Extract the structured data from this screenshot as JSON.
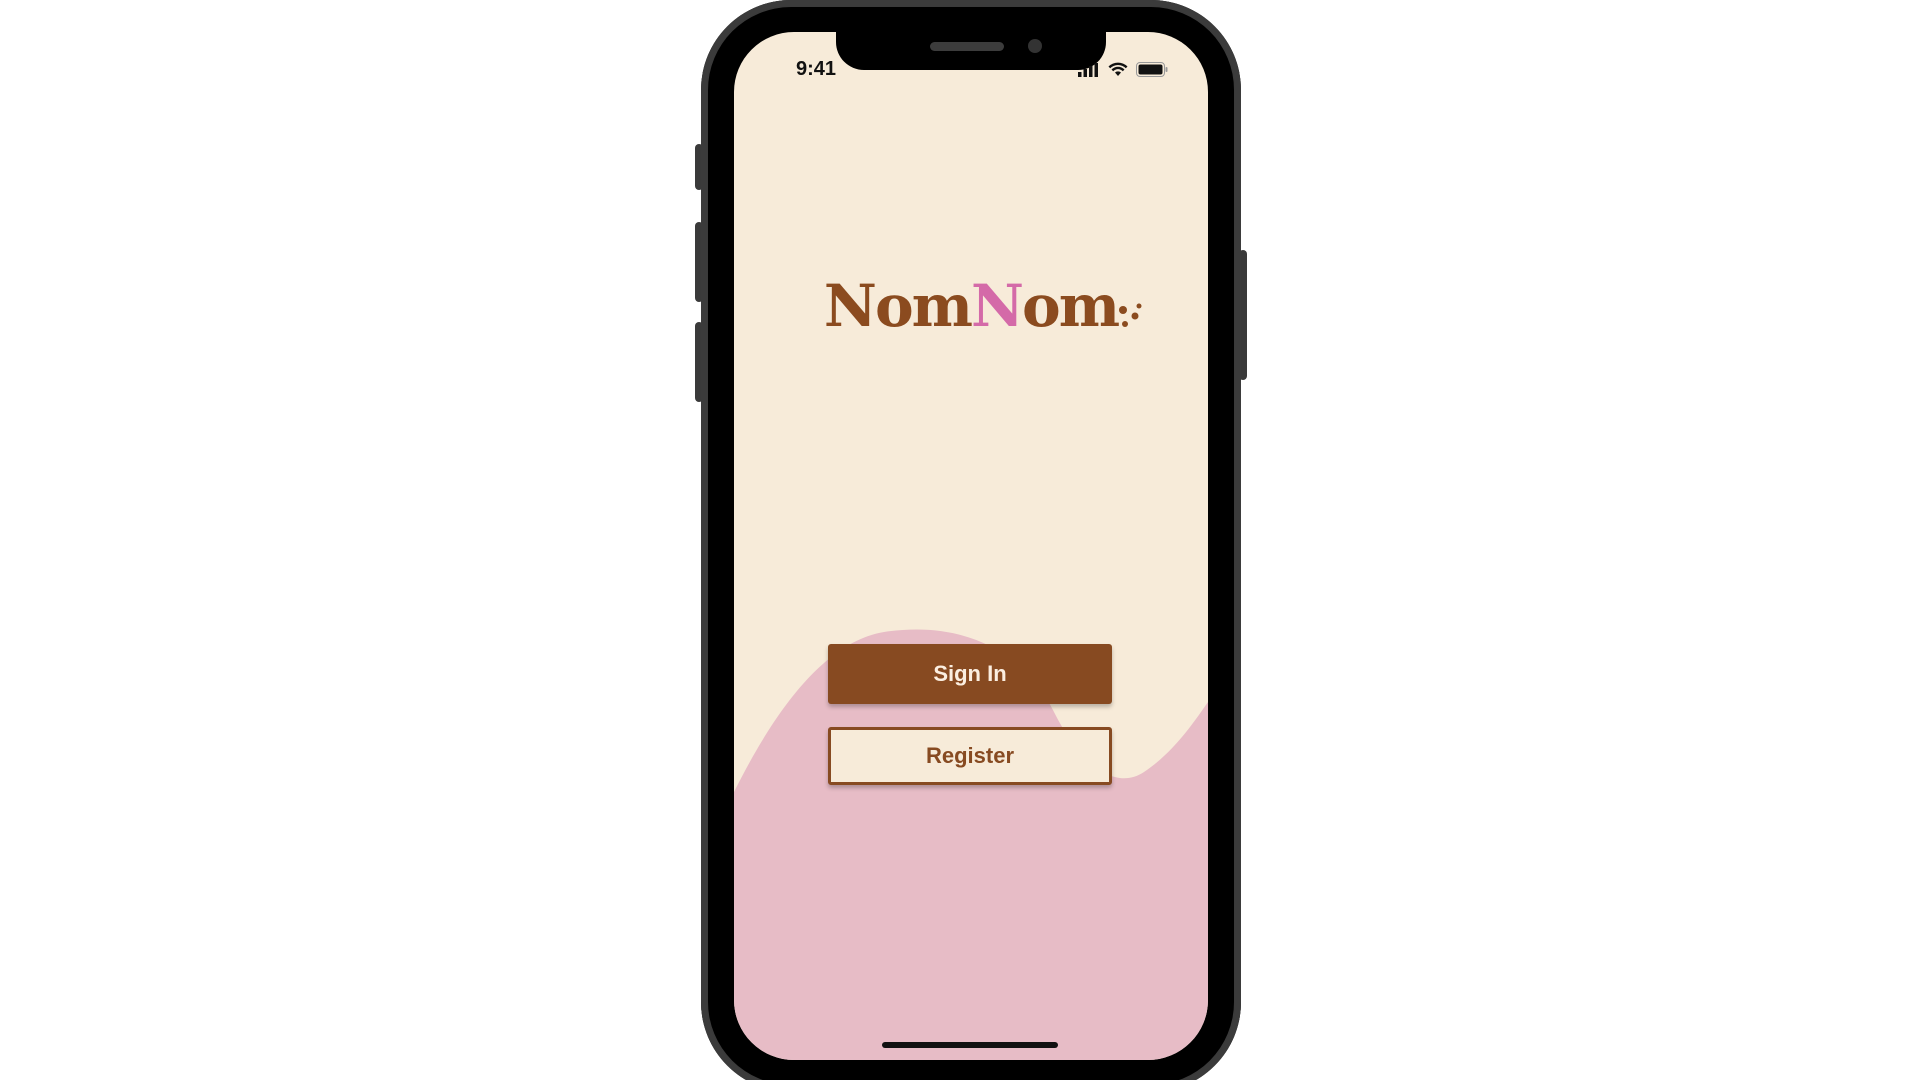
{
  "status_bar": {
    "time": "9:41",
    "icons": [
      "cellular-signal-icon",
      "wifi-icon",
      "battery-icon"
    ]
  },
  "logo": {
    "part1": "Nom",
    "part2": "N",
    "part3": "om"
  },
  "buttons": {
    "sign_in": "Sign In",
    "register": "Register"
  },
  "colors": {
    "background": "#f7ebd9",
    "brand_brown": "#874a21",
    "accent_pink": "#d46aa8",
    "blob_pink": "#e7bcc6"
  }
}
